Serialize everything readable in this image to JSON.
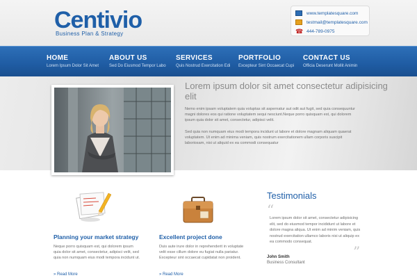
{
  "header": {
    "logo": "Centivio",
    "tagline": "Business Plan & Strategy",
    "contact": {
      "website": "www.templatesquare.com",
      "email": "testmail@templatesquare.com",
      "phone": "444-789-0975"
    }
  },
  "nav": [
    {
      "label": "HOME",
      "sub": "Lorem Ipsum Dolor Sit Amet"
    },
    {
      "label": "ABOUT US",
      "sub": "Sed Do Eiusmod Tempor Labo"
    },
    {
      "label": "SERVICES",
      "sub": "Quis Nostrud Exercitation Edi"
    },
    {
      "label": "PORTFOLIO",
      "sub": "Excepteur Sint Occaecat Cupi"
    },
    {
      "label": "CONTACT US",
      "sub": "Officia Deserunt Mollit Animin"
    }
  ],
  "hero": {
    "title": "Lorem ipsum dolor sit amet consectetur adipisicing elit",
    "p1": "Nemo enim ipsam voluptatem quia voluptas sit aspernatur aut odit aut fugit, sed quia consequuntur magni dolores eos qui ratione voluptatem sequi nesciunt.Neque porro quisquam est, qui dolorem ipsum quia dolor sit amet, consectetur, adipisci velit.",
    "p2": "Sed quia non numquam eius modi tempora incidunt ut labore et dolore magnam aliquam quaerat voluptatem. Ut enim ad minima veniam, quis nostrum exercitationem ullam corporis suscipit laboriosam, nisi ut aliquid ex ea commodi consequatur"
  },
  "features": [
    {
      "title": "Planning your market strategy",
      "text": "Neque porro quisquam est, qui dolorem ipsum quia dolor sit amet, consectetur, adipisci velit, sed quia non numquam eius modi tempora incidunt ut.",
      "read_more": "Read More"
    },
    {
      "title": "Excellent project done",
      "text": "Duis aute irure dolor in reprehenderit in voluptate velit esse cillum dolore eu fugiat nulla pariatur. Excepteur sint occaecat cupidatat non proident.",
      "read_more": "Read More"
    }
  ],
  "testimonials": {
    "title": "Testimonials",
    "text": "Lorem ipsum dolor sit amet, consectetur adipisicing elit, sed do eiusmod tempor incididunt ut labore et dolore magna aliqua. Ut enim ad minim veniam, quis nostrud exercitation ullamco laboris nisi ut aliquip ex ea commodo consequat.",
    "name": "John Smith",
    "role": "Business Consultant"
  },
  "colors": {
    "brand_blue": "#1f5fa8",
    "nav_blue": "#2366b0",
    "body_text": "#6e6e6e"
  }
}
